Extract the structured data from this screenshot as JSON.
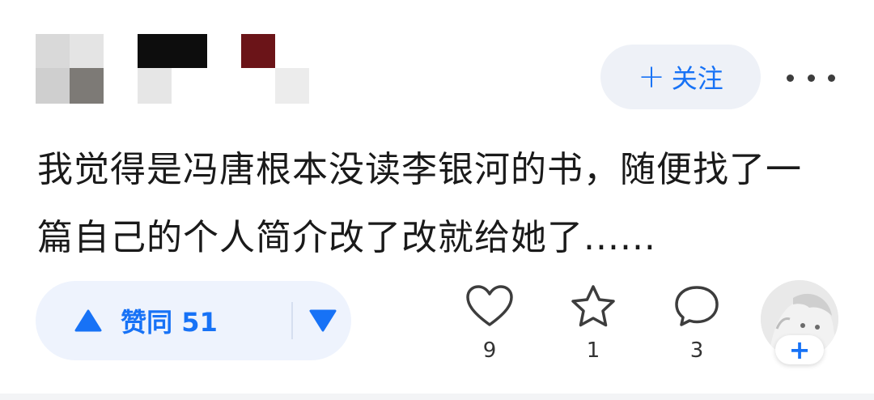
{
  "header": {
    "follow_label": "关注",
    "follow_icon": "plus-icon",
    "more_icon": "more-dots-icon"
  },
  "comment": {
    "text": "我觉得是冯唐根本没读李银河的书，随便找了一篇自己的个人简介改了改就给她了......"
  },
  "vote": {
    "up_label": "赞同 51",
    "up_icon": "triangle-up-icon",
    "down_icon": "triangle-down-icon"
  },
  "actions": {
    "like": {
      "icon": "heart-icon",
      "count": "9"
    },
    "favorite": {
      "icon": "star-icon",
      "count": "1"
    },
    "comment": {
      "icon": "comment-bubble-icon",
      "count": "3"
    }
  },
  "avatar": {
    "add_label": "+"
  },
  "colors": {
    "accent": "#1772f6",
    "follow_bg": "#eef1f7",
    "vote_bg": "#eef3fd",
    "text": "#1a1a1a",
    "icon": "#3d3d3d"
  }
}
